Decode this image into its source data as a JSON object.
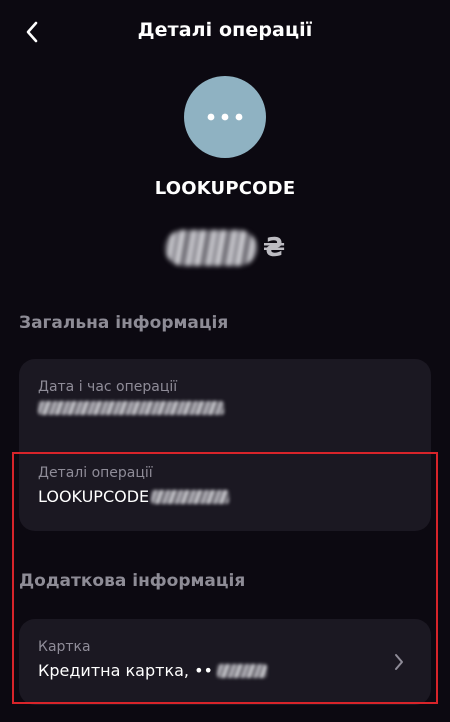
{
  "header": {
    "title": "Деталі операції"
  },
  "merchant": {
    "name": "LOOKUPCODE",
    "avatar_icon": "more-dots-icon",
    "avatar_color": "#8fb2c2"
  },
  "amount": {
    "currency": "₴"
  },
  "general_section": {
    "title": "Загальна інформація",
    "date_label": "Дата і час операції",
    "details_label": "Деталі операції",
    "details_value": "LOOKUPCODE"
  },
  "additional_section": {
    "title": "Додаткова інформація",
    "card_label": "Картка",
    "card_value": "Кредитна картка, ••"
  },
  "colors": {
    "background": "#0c0911",
    "card": "#1b1822",
    "muted_text": "#8f8c98",
    "highlight": "#d8242a"
  }
}
